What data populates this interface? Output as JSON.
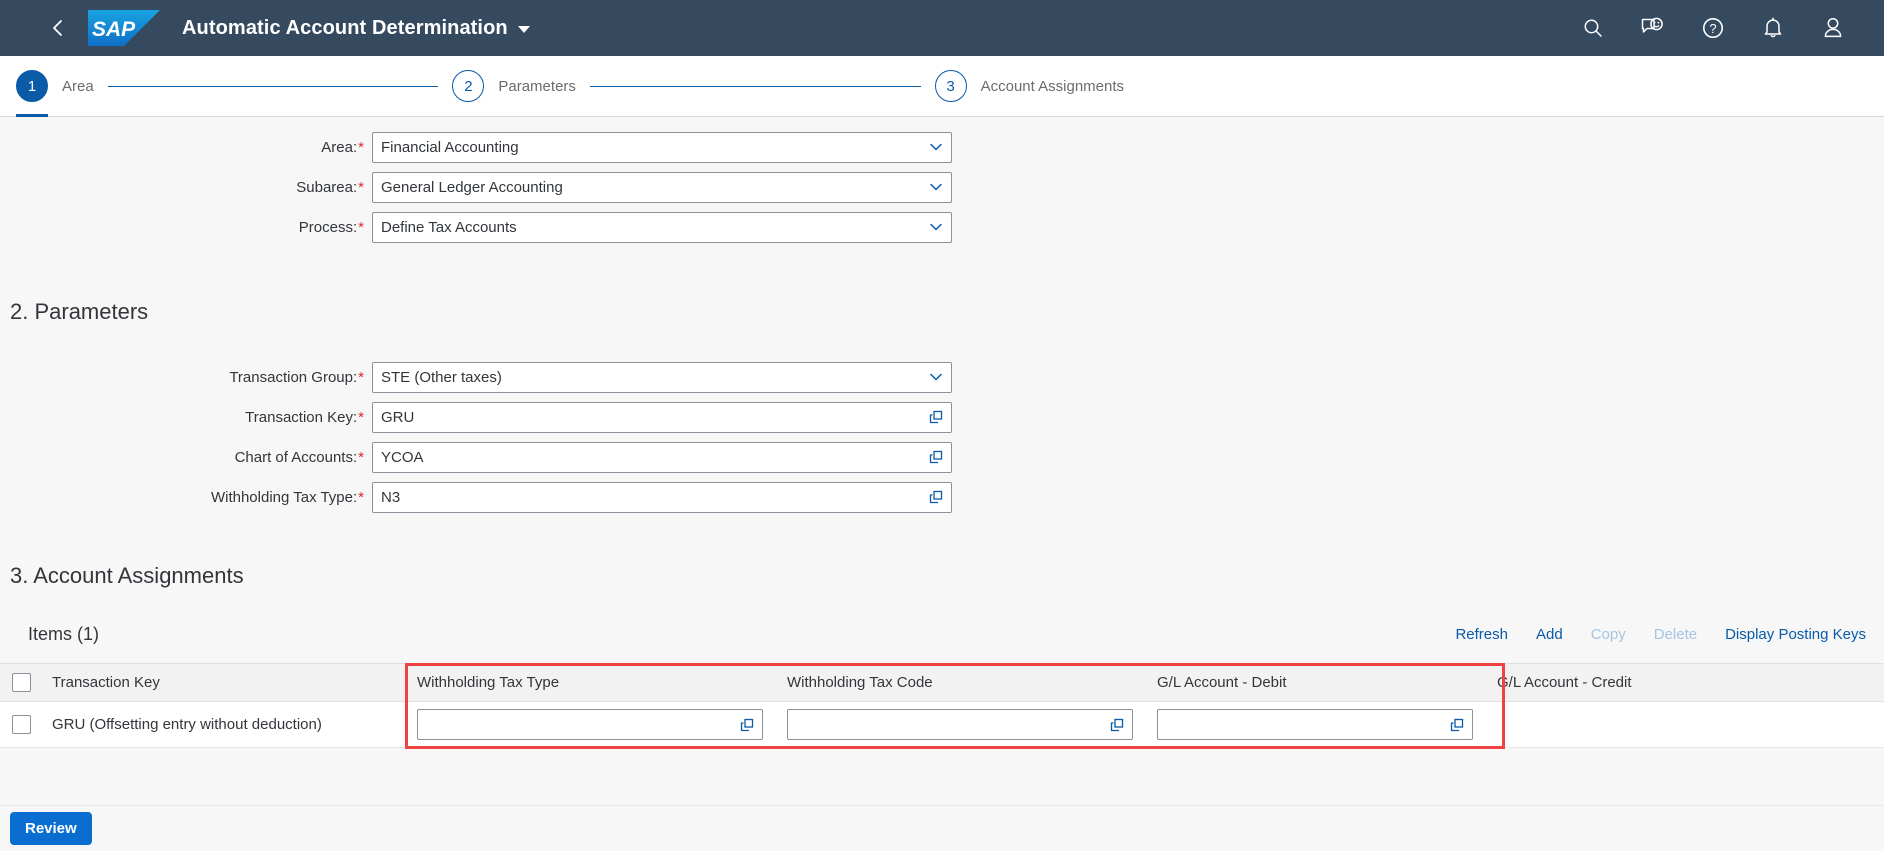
{
  "shell": {
    "back_label": "Back",
    "logo_text": "SAP",
    "app_title": "Automatic Account Determination",
    "icons": [
      {
        "name": "search-icon",
        "label": "Search"
      },
      {
        "name": "feedback-icon",
        "label": "Feedback"
      },
      {
        "name": "help-icon",
        "label": "Help"
      },
      {
        "name": "bell-icon",
        "label": "Notifications"
      },
      {
        "name": "user-icon",
        "label": "User"
      }
    ],
    "bg_color": "#354a5f"
  },
  "wizard": {
    "accent_color": "#0a5aa8",
    "steps": [
      {
        "number": "1",
        "label": "Area",
        "state": "active"
      },
      {
        "number": "2",
        "label": "Parameters",
        "state": "inactive"
      },
      {
        "number": "3",
        "label": "Account Assignments",
        "state": "inactive"
      }
    ]
  },
  "area_section": {
    "fields": [
      {
        "label": "Area:",
        "required": true,
        "value": "Financial Accounting",
        "control": "select"
      },
      {
        "label": "Subarea:",
        "required": true,
        "value": "General Ledger Accounting",
        "control": "select"
      },
      {
        "label": "Process:",
        "required": true,
        "value": "Define Tax Accounts",
        "control": "select"
      }
    ]
  },
  "parameters_section": {
    "title": "2. Parameters",
    "fields": [
      {
        "label": "Transaction Group:",
        "required": true,
        "value": "STE (Other taxes)",
        "control": "select"
      },
      {
        "label": "Transaction Key:",
        "required": true,
        "value": "GRU",
        "control": "valuehelp"
      },
      {
        "label": "Chart of Accounts:",
        "required": true,
        "value": "YCOA",
        "control": "valuehelp"
      },
      {
        "label": "Withholding Tax Type:",
        "required": true,
        "value": "N3",
        "control": "valuehelp"
      }
    ]
  },
  "assignments_section": {
    "title": "3. Account Assignments",
    "items_title": "Items (1)",
    "actions": [
      {
        "label": "Refresh",
        "enabled": true
      },
      {
        "label": "Add",
        "enabled": true
      },
      {
        "label": "Copy",
        "enabled": false
      },
      {
        "label": "Delete",
        "enabled": false
      },
      {
        "label": "Display Posting Keys",
        "enabled": true
      }
    ],
    "columns": [
      "Transaction Key",
      "Withholding Tax Type",
      "Withholding Tax Code",
      "G/L Account - Debit",
      "G/L Account - Credit"
    ],
    "rows": [
      {
        "selected": false,
        "transaction_key": "GRU (Offsetting entry without deduction)",
        "withholding_tax_type": "",
        "withholding_tax_code": "",
        "gl_account_debit": "",
        "gl_account_credit": ""
      }
    ],
    "highlight_color": "#ef4343"
  },
  "footer": {
    "review_label": "Review",
    "button_color": "#0a6ed1"
  }
}
